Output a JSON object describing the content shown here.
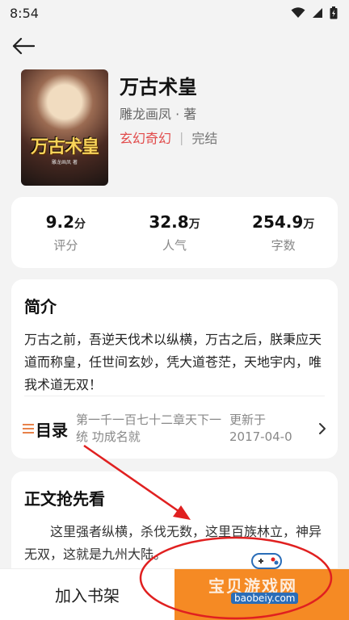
{
  "status_bar": {
    "time": "8:54"
  },
  "book": {
    "title": "万古术皇",
    "author": "雕龙画凤 · 著",
    "genre": "玄幻奇幻",
    "separator": "|",
    "status": "完结",
    "cover_title": "万古术皇",
    "cover_subtitle": "雕龙画凤 著"
  },
  "stats": [
    {
      "value": "9.2",
      "unit": "分",
      "label": "评分"
    },
    {
      "value": "32.8",
      "unit": "万",
      "label": "人气"
    },
    {
      "value": "254.9",
      "unit": "万",
      "label": "字数"
    }
  ],
  "intro": {
    "title": "简介",
    "text": "万古之前，吾逆天伐术以纵横，万古之后，朕秉应天道而称皇，任世间玄妙，凭大道苍茫，天地宇内，唯我术道无双！"
  },
  "toc": {
    "label": "目录",
    "latest_chapter": "第一千一百七十二章天下一统 功成名就",
    "updated": "更新于 2017-04-0"
  },
  "preview": {
    "title": "正文抢先看",
    "text": "这里强者纵横，杀伐无数，这里百族林立，神异无双，这就是九州大陆。"
  },
  "bottom_bar": {
    "add_to_shelf": "加入书架",
    "read_now": ""
  },
  "watermark": {
    "text": "宝贝游戏网",
    "url": "baobeiy.com"
  },
  "colors": {
    "accent": "#f58a24",
    "genre": "#e14a4a",
    "background": "#f3f3f3"
  }
}
